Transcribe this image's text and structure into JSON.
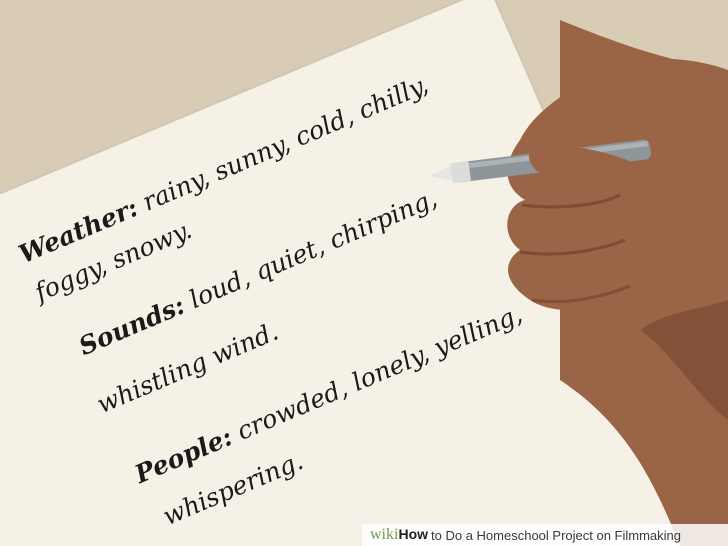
{
  "colors": {
    "background": "#d9cdb6",
    "paper": "#f6f1e7",
    "paper_edge": "#cfc6b4",
    "skin": "#9a6446",
    "skin_shadow": "#6f412b",
    "pen_body": "#8f969a",
    "pen_tip": "#e6e6e6",
    "ink": "#1a1a1a"
  },
  "notes": [
    {
      "label": "Weather:",
      "text": "rainy, sunny, cold, chilly,"
    },
    {
      "label": "",
      "text": "foggy, snowy."
    },
    {
      "label": "Sounds:",
      "text": "loud, quiet, chirping,"
    },
    {
      "label": "",
      "text": "whistling wind."
    },
    {
      "label": "People:",
      "text": "crowded, lonely, yelling,"
    },
    {
      "label": "",
      "text": "whispering."
    }
  ],
  "watermark": {
    "brand": "wiki",
    "how": "How",
    "text": "to Do a Homeschool Project on Filmmaking"
  }
}
